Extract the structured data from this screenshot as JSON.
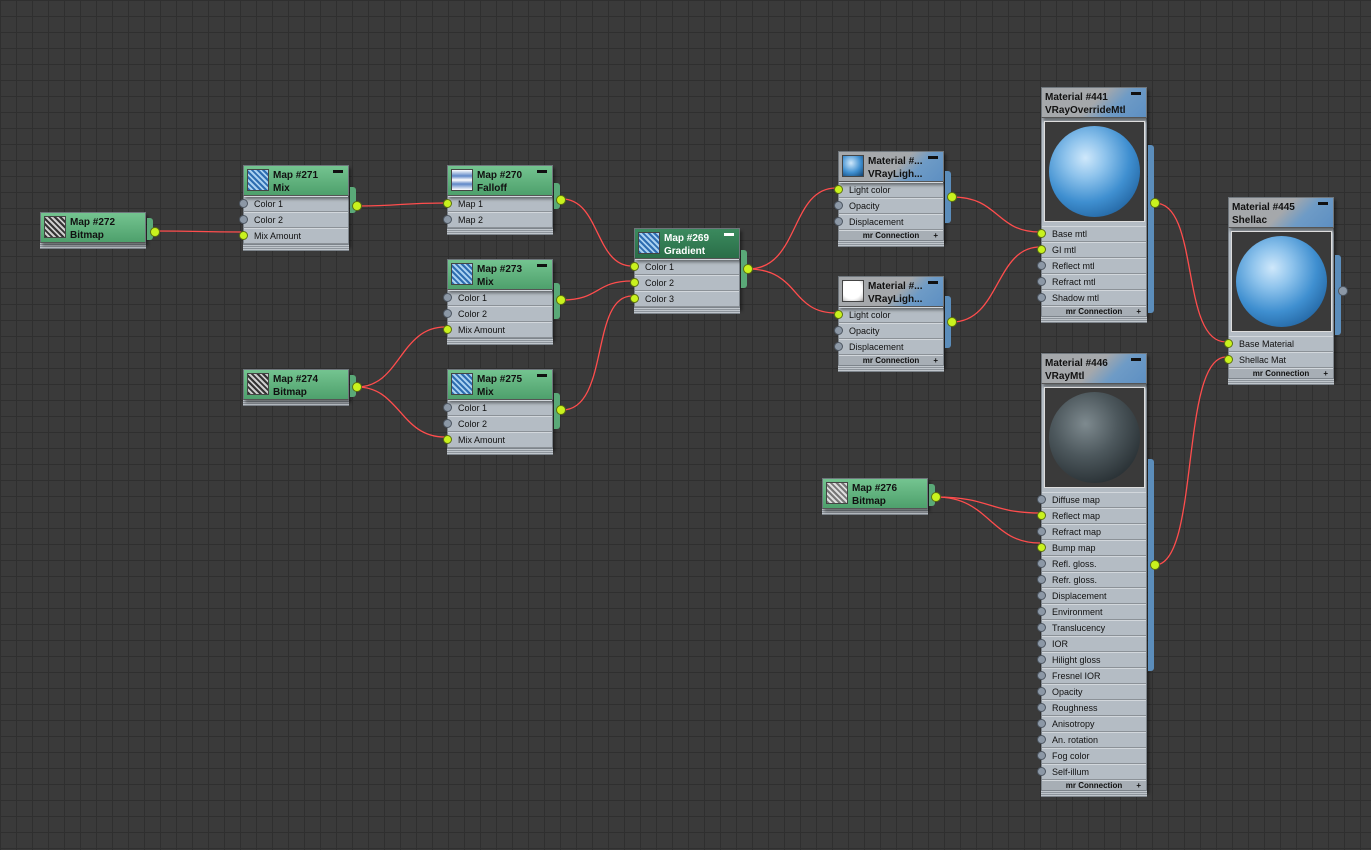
{
  "nodes": {
    "map272": {
      "title": "Map #272",
      "type": "Bitmap"
    },
    "map271": {
      "title": "Map #271",
      "type": "Mix",
      "slots": [
        "Color 1",
        "Color 2",
        "Mix Amount"
      ]
    },
    "map270": {
      "title": "Map #270",
      "type": "Falloff",
      "slots": [
        "Map 1",
        "Map 2"
      ]
    },
    "map273": {
      "title": "Map #273",
      "type": "Mix",
      "slots": [
        "Color 1",
        "Color 2",
        "Mix Amount"
      ]
    },
    "map274": {
      "title": "Map #274",
      "type": "Bitmap"
    },
    "map275": {
      "title": "Map #275",
      "type": "Mix",
      "slots": [
        "Color 1",
        "Color 2",
        "Mix Amount"
      ]
    },
    "map269": {
      "title": "Map #269",
      "type": "Gradient",
      "slots": [
        "Color 1",
        "Color 2",
        "Color 3"
      ]
    },
    "matA": {
      "title": "Material #...",
      "type": "VRayLigh...",
      "slots": [
        "Light color",
        "Opacity",
        "Displacement"
      ],
      "footer": "mr Connection"
    },
    "matB": {
      "title": "Material #...",
      "type": "VRayLigh...",
      "slots": [
        "Light color",
        "Opacity",
        "Displacement"
      ],
      "footer": "mr Connection"
    },
    "mat441": {
      "title": "Material #441",
      "type": "VRayOverrideMtl",
      "slots": [
        "Base mtl",
        "GI mtl",
        "Reflect mtl",
        "Refract mtl",
        "Shadow mtl"
      ],
      "footer": "mr Connection"
    },
    "mat445": {
      "title": "Material #445",
      "type": "Shellac",
      "slots": [
        "Base Material",
        "Shellac Mat"
      ],
      "footer": "mr Connection"
    },
    "mat446": {
      "title": "Material #446",
      "type": "VRayMtl",
      "slots": [
        "Diffuse map",
        "Reflect map",
        "Refract map",
        "Bump map",
        "Refl. gloss.",
        "Refr. gloss.",
        "Displacement",
        "Environment",
        "Translucency",
        "IOR",
        "Hilight gloss",
        "Fresnel IOR",
        "Opacity",
        "Roughness",
        "Anisotropy",
        "An. rotation",
        "Fog color",
        "Self-illum"
      ],
      "footer": "mr Connection"
    },
    "map276": {
      "title": "Map #276",
      "type": "Bitmap"
    }
  },
  "minimize_glyph": "▬",
  "footer_glyph": "+",
  "colors": {
    "wire": "#ff4d4d",
    "socket_active": "#c9f21e",
    "socket_idle": "#8c98a6",
    "map_header": "#5aa978",
    "material_accent": "#5b8dbb"
  }
}
